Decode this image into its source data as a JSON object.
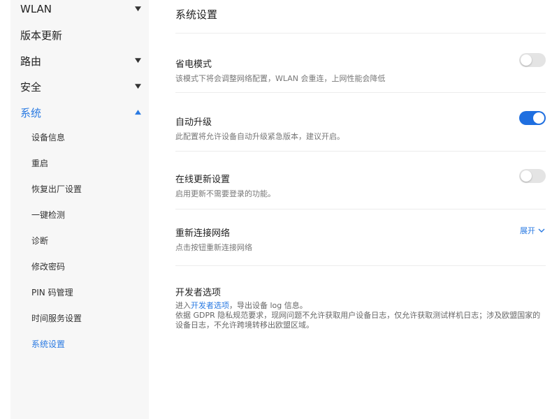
{
  "sidebar": {
    "items": [
      {
        "label": "WLAN",
        "expanded": false
      },
      {
        "label": "版本更新"
      },
      {
        "label": "路由",
        "expanded": false
      },
      {
        "label": "安全",
        "expanded": false
      },
      {
        "label": "系统",
        "expanded": true
      }
    ],
    "system_submenu": [
      "设备信息",
      "重启",
      "恢复出厂设置",
      "一键检测",
      "诊断",
      "修改密码",
      "PIN 码管理",
      "时间服务设置",
      "系统设置"
    ],
    "active_submenu": "系统设置"
  },
  "main": {
    "title": "系统设置",
    "rows": [
      {
        "title": "省电模式",
        "desc": "该模式下将会调整网络配置，WLAN 会重连，上网性能会降低",
        "toggle_on": false
      },
      {
        "title": "自动升级",
        "desc": "此配置将允许设备自动升级紧急版本，建议开启。",
        "toggle_on": true
      },
      {
        "title": "在线更新设置",
        "desc": "启用更新不需要登录的功能。",
        "toggle_on": false
      },
      {
        "title": "重新连接网络",
        "desc": "点击按钮重新连接网络",
        "action_label": "展开"
      }
    ],
    "developer": {
      "title": "开发者选项",
      "line1_prefix": "进入",
      "line1_link": "开发者选项",
      "line1_suffix": "，导出设备 log 信息。",
      "line2": "依据 GDPR 隐私规范要求，现网问题不允许获取用户设备日志，仅允许获取测试样机日志；涉及欧盟国家的设备日志，不允许跨境转移出欧盟区域。"
    }
  },
  "colors": {
    "accent": "#2a7ae2",
    "toggle_on": "#1f6fe0",
    "toggle_off": "#e4e4e4",
    "sidebar_bg": "#f7f7f7"
  }
}
